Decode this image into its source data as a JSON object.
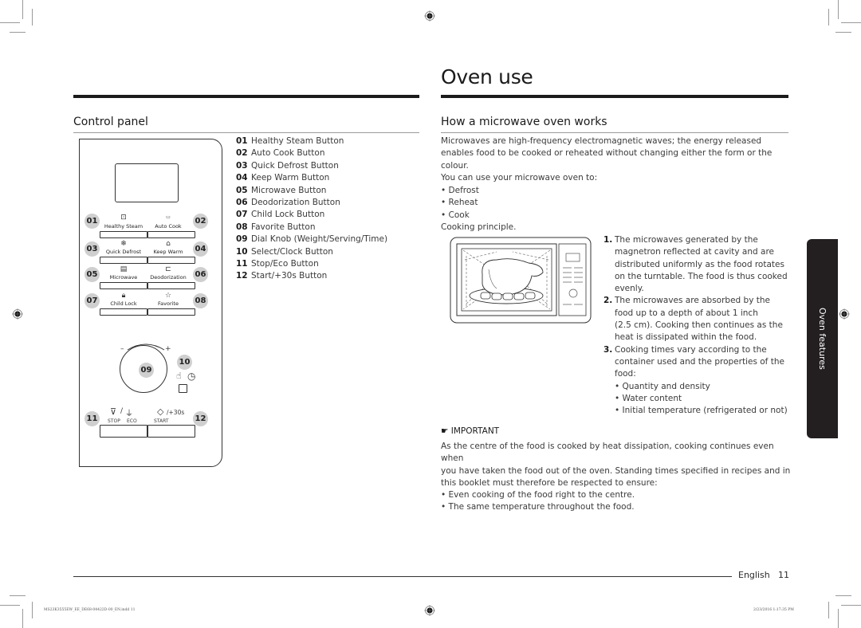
{
  "page": {
    "title": "Oven use",
    "side_tab": "Oven features",
    "footer": {
      "language": "English",
      "page_number": "11"
    },
    "meta": {
      "file": "MS23K3555EW_EE_DE68-04422D-00_EN.indd   11",
      "timestamp": "2/23/2016   1:17:35 PM"
    }
  },
  "control_panel": {
    "title": "Control panel",
    "panel_buttons": [
      {
        "num": "01",
        "label": "Healthy Steam",
        "icon": "steam-icon"
      },
      {
        "num": "02",
        "label": "Auto Cook",
        "icon": "auto-icon"
      },
      {
        "num": "03",
        "label": "Quick Defrost",
        "icon": "defrost-icon"
      },
      {
        "num": "04",
        "label": "Keep Warm",
        "icon": "keep-warm-icon"
      },
      {
        "num": "05",
        "label": "Microwave",
        "icon": "microwave-icon"
      },
      {
        "num": "06",
        "label": "Deodorization",
        "icon": "deodorization-icon"
      },
      {
        "num": "07",
        "label": "Child Lock",
        "icon": "lock-icon"
      },
      {
        "num": "08",
        "label": "Favorite",
        "icon": "star-icon"
      }
    ],
    "dial": {
      "num": "09",
      "minus": "–",
      "plus": "+"
    },
    "select": {
      "num": "10"
    },
    "stop": {
      "num": "11",
      "label_stop": "STOP",
      "label_eco": "ECO",
      "slash": "/"
    },
    "start": {
      "num": "12",
      "label_start": "START",
      "label_extra": "/+30s"
    },
    "legend": [
      {
        "num": "01",
        "text": "Healthy Steam Button"
      },
      {
        "num": "02",
        "text": "Auto Cook Button"
      },
      {
        "num": "03",
        "text": "Quick Defrost Button"
      },
      {
        "num": "04",
        "text": "Keep Warm Button"
      },
      {
        "num": "05",
        "text": "Microwave Button"
      },
      {
        "num": "06",
        "text": "Deodorization Button"
      },
      {
        "num": "07",
        "text": "Child Lock Button"
      },
      {
        "num": "08",
        "text": "Favorite Button"
      },
      {
        "num": "09",
        "text": "Dial Knob (Weight/Serving/Time)"
      },
      {
        "num": "10",
        "text": "Select/Clock Button"
      },
      {
        "num": "11",
        "text": "Stop/Eco Button"
      },
      {
        "num": "12",
        "text": "Start/+30s Button"
      }
    ]
  },
  "how_it_works": {
    "title": "How a microwave oven works",
    "intro_lines": [
      "Microwaves are high-frequency electromagnetic waves; the energy released",
      "enables food to be cooked or reheated without changing either the form or the",
      "colour."
    ],
    "uses_intro": "You can use your microwave oven to:",
    "uses": [
      "Defrost",
      "Reheat",
      "Cook"
    ],
    "principle_label": "Cooking principle.",
    "steps": [
      {
        "num": "1.",
        "lines": [
          "The microwaves generated by the",
          "magnetron reflected at cavity and are",
          "distributed uniformly as the food rotates",
          "on the turntable. The food is thus cooked",
          "evenly."
        ]
      },
      {
        "num": "2.",
        "lines": [
          "The microwaves are absorbed by the",
          "food up to a depth of about 1 inch",
          "(2.5 cm). Cooking then continues as the",
          "heat is dissipated within the food."
        ]
      },
      {
        "num": "3.",
        "lines": [
          "Cooking times vary according to the",
          "container used and the properties of the",
          "food:"
        ]
      }
    ],
    "factors": [
      "Quantity and density",
      "Water content",
      "Initial temperature (refrigerated or not)"
    ],
    "important": {
      "label": "IMPORTANT",
      "lines": [
        "As the centre of the food is cooked by heat dissipation, cooking continues even when",
        "you have taken the food out of the oven. Standing times specified in recipes and in",
        "this booklet must therefore be respected to ensure:"
      ],
      "bullets": [
        "Even cooking of the food right to the centre.",
        "The same temperature throughout the food."
      ]
    }
  }
}
